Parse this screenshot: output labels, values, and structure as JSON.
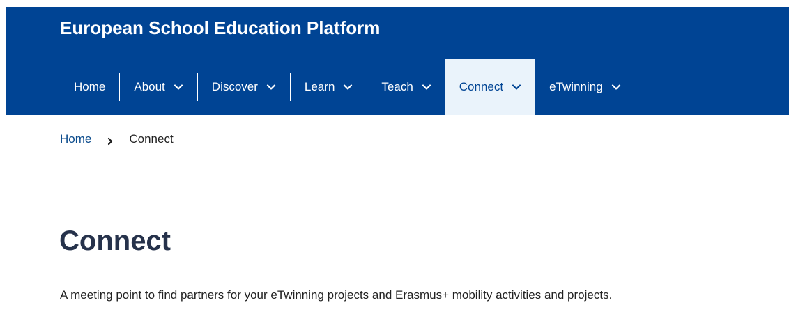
{
  "header": {
    "site_title": "European School Education Platform",
    "background_color": "#004494"
  },
  "nav": {
    "items": [
      {
        "label": "Home",
        "has_dropdown": false,
        "active": false
      },
      {
        "label": "About",
        "has_dropdown": true,
        "active": false
      },
      {
        "label": "Discover",
        "has_dropdown": true,
        "active": false
      },
      {
        "label": "Learn",
        "has_dropdown": true,
        "active": false
      },
      {
        "label": "Teach",
        "has_dropdown": true,
        "active": false
      },
      {
        "label": "Connect",
        "has_dropdown": true,
        "active": true
      },
      {
        "label": "eTwinning",
        "has_dropdown": true,
        "active": false
      }
    ],
    "active_background": "#eaf3fb",
    "dropdown_icon": "chevron-down-icon"
  },
  "breadcrumb": {
    "home_label": "Home",
    "separator_icon": "chevron-right-icon",
    "current_label": "Connect"
  },
  "main": {
    "title": "Connect",
    "intro": "A meeting point to find partners for your eTwinning projects and Erasmus+ mobility activities and projects."
  }
}
